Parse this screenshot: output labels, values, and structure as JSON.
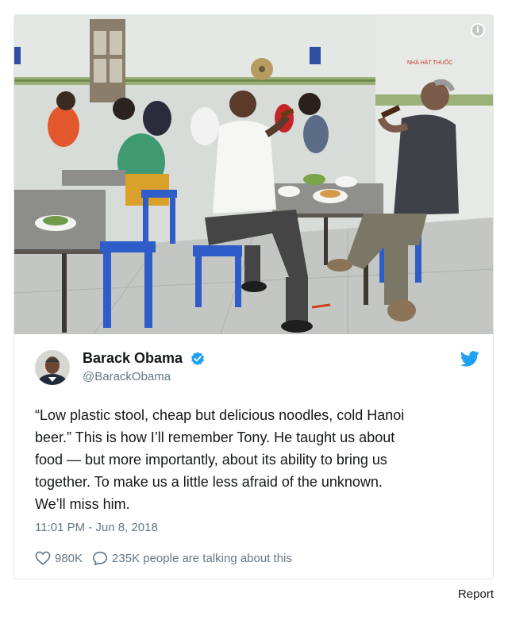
{
  "tweet": {
    "display_name": "Barack Obama",
    "handle": "@BarackObama",
    "verified": true,
    "text_lines": [
      "“Low plastic stool, cheap but delicious noodles, cold Hanoi",
      "beer.” This is how I’ll remember Tony. He taught us about",
      "food — but more importantly, about its ability to bring us",
      "together. To make us a little less afraid of the unknown.",
      "We’ll miss him."
    ],
    "timestamp": "11:01 PM - Jun 8, 2018",
    "likes": "980K",
    "replies_text": "235K people are talking about this"
  },
  "icons": {
    "info": "info-icon",
    "verified": "verified-badge-icon",
    "brand": "twitter-bird-icon",
    "like": "heart-icon",
    "reply": "speech-bubble-icon"
  },
  "colors": {
    "brand_blue": "#1da1f2",
    "secondary_text": "#657786",
    "border": "#e1e8ed"
  },
  "footer": {
    "report_label": "Report"
  }
}
